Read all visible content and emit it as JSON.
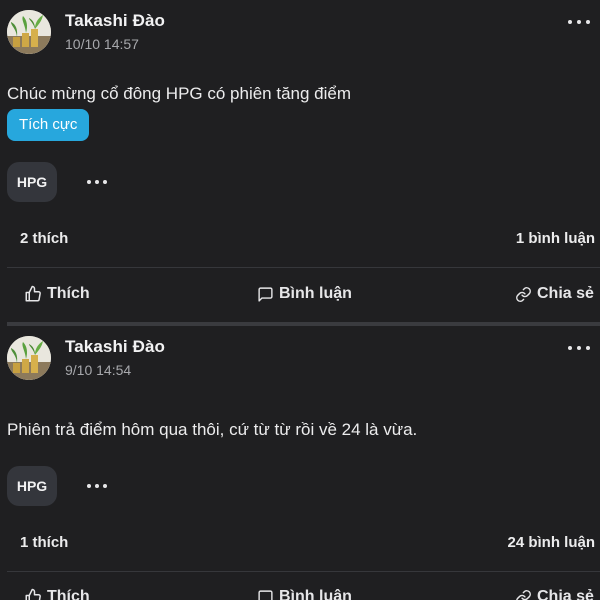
{
  "posts": [
    {
      "author": "Takashi Đào",
      "time": "10/10 14:57",
      "content": "Chúc mừng cổ đông HPG có phiên tăng điểm",
      "sentiment": "Tích cực",
      "ticker": "HPG",
      "likes_text": "2 thích",
      "comments_text": "1 bình luận",
      "actions": {
        "like": "Thích",
        "comment": "Bình luận",
        "share": "Chia sẻ"
      }
    },
    {
      "author": "Takashi Đào",
      "time": "9/10 14:54",
      "content": "Phiên trả điểm hôm qua thôi, cứ từ từ rồi về 24 là vừa.",
      "ticker": "HPG",
      "likes_text": "1 thích",
      "comments_text": "24 bình luận",
      "actions": {
        "like": "Thích",
        "comment": "Bình luận",
        "share": "Chia sẻ"
      }
    }
  ],
  "colors": {
    "background": "#1f1f21",
    "sentiment_badge": "#27a7dd",
    "ticker_chip": "#34363c",
    "muted_text": "#a7a8ac"
  },
  "icons": {
    "avatar": "plant-coins-avatar",
    "more": "more-horizontal-icon",
    "like": "thumbs-up-icon",
    "comment": "comment-bubble-icon",
    "share": "link-chain-icon"
  }
}
